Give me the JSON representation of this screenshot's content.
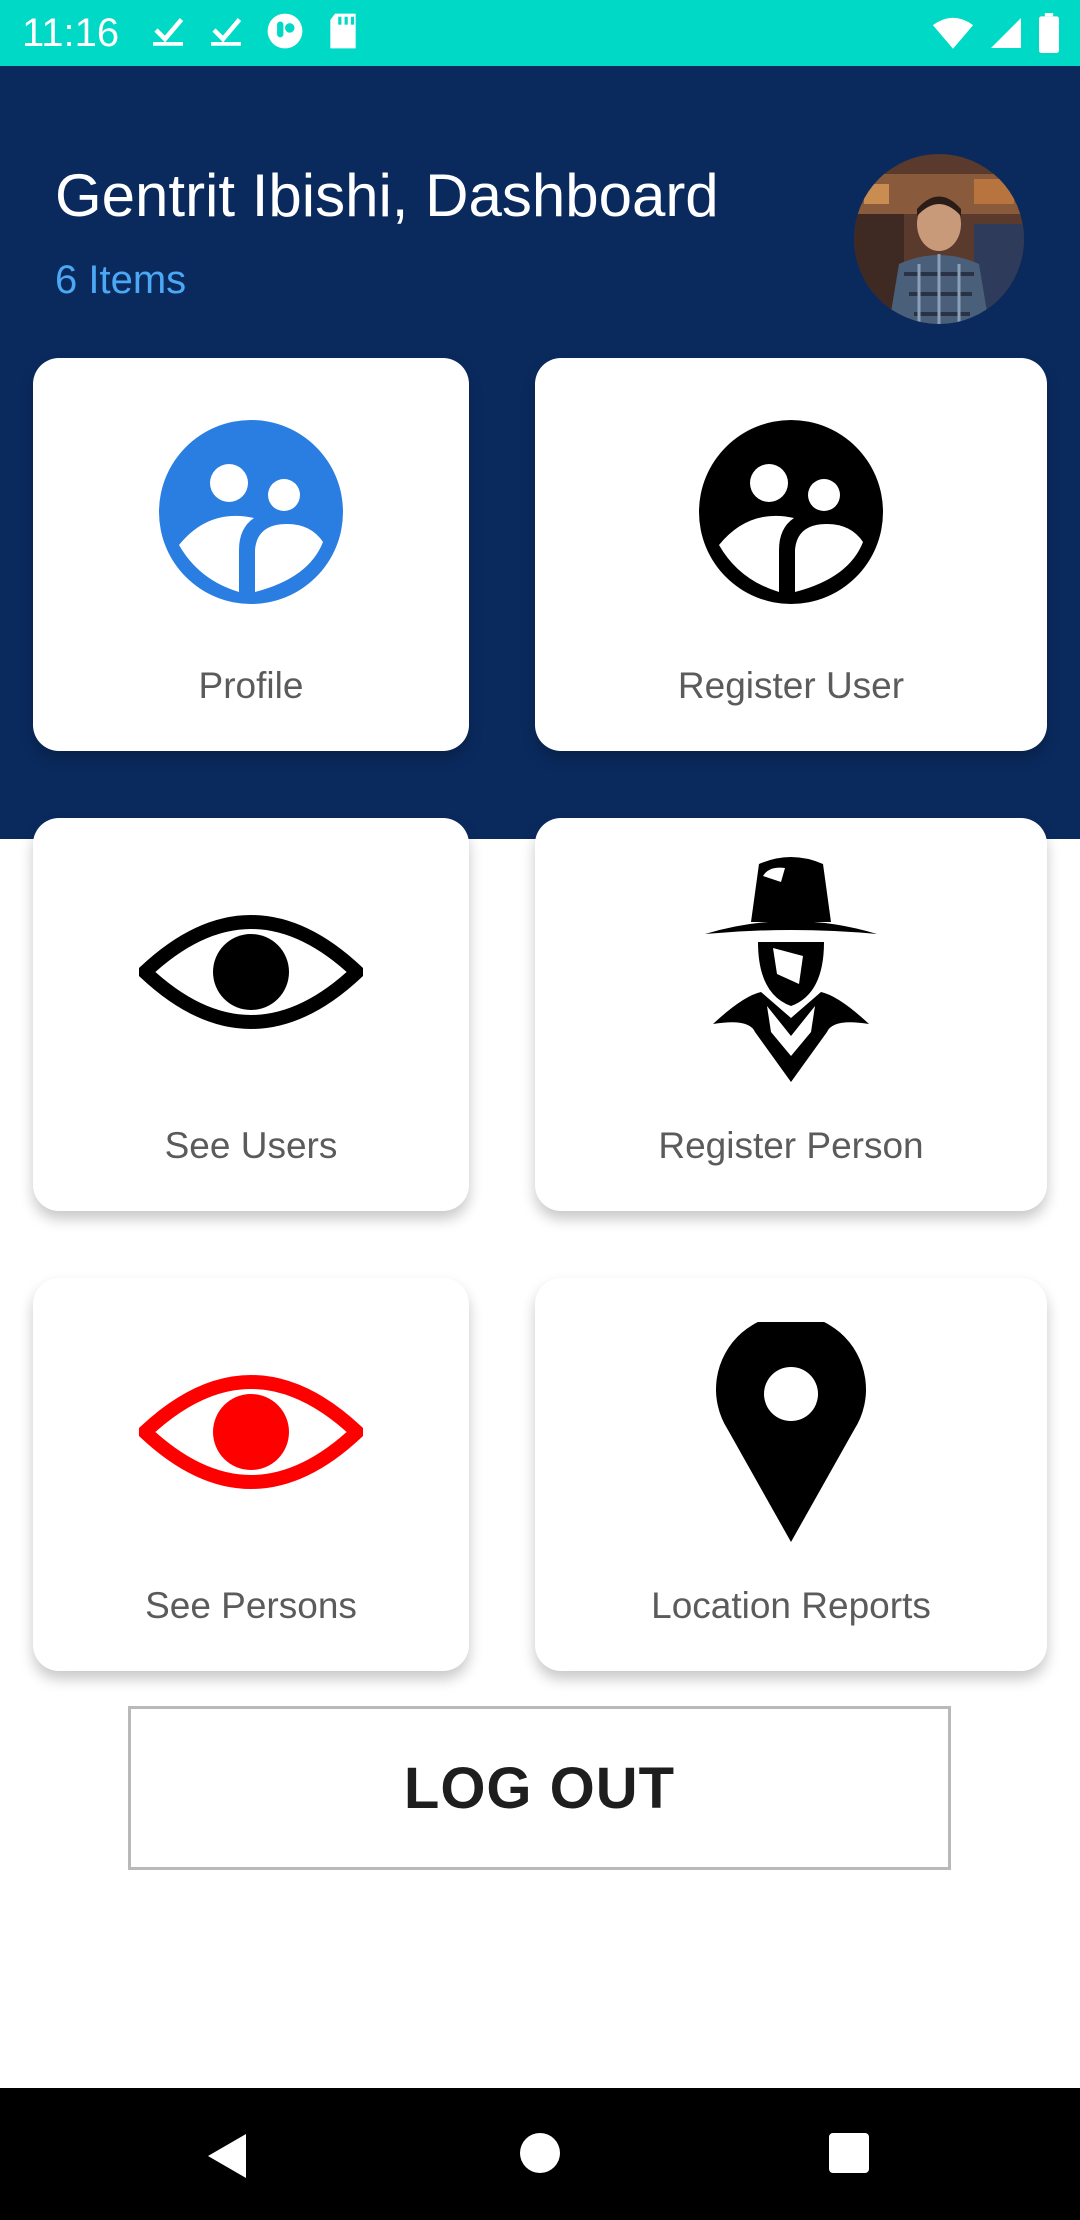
{
  "status_bar": {
    "time": "11:16",
    "left_icons": [
      "check-download-icon",
      "check-download-icon",
      "app-icon",
      "sd-card-icon"
    ],
    "right_icons": [
      "wifi-icon",
      "signal-icon",
      "battery-icon"
    ],
    "color": "#00d9c5"
  },
  "header": {
    "title": "Gentrit Ibishi, Dashboard",
    "subtitle": "6 Items",
    "background": "#0a2a5e",
    "subtitle_color": "#4aa8f5"
  },
  "cards": [
    {
      "label": "Profile",
      "icon": "users-group-icon",
      "icon_color": "#2a7de1"
    },
    {
      "label": "Register User",
      "icon": "users-group-icon",
      "icon_color": "#000000"
    },
    {
      "label": "See Users",
      "icon": "eye-icon",
      "icon_color": "#000000"
    },
    {
      "label": "Register Person",
      "icon": "detective-icon",
      "icon_color": "#000000"
    },
    {
      "label": "See Persons",
      "icon": "eye-icon",
      "icon_color": "#ff0000"
    },
    {
      "label": "Location Reports",
      "icon": "location-pin-icon",
      "icon_color": "#000000"
    }
  ],
  "logout": {
    "label": "LOG OUT"
  },
  "nav_bar": {
    "icons": [
      "back-icon",
      "home-icon",
      "recents-icon"
    ]
  }
}
